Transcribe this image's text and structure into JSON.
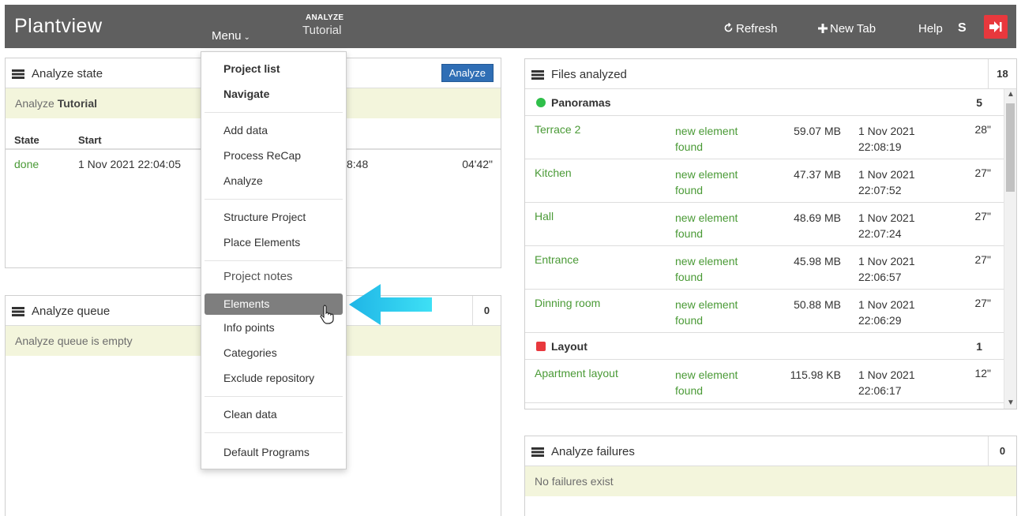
{
  "topbar": {
    "brand": "Plantview",
    "menu_label": "Menu",
    "crumb_small": "ANALYZE",
    "crumb_big": "Tutorial",
    "refresh": "Refresh",
    "new_tab": "New Tab",
    "help": "Help",
    "user": "S"
  },
  "state_panel": {
    "title": "Analyze state",
    "analyze_button": "Analyze",
    "note_prefix": "Analyze",
    "note_project": "Tutorial",
    "col_state": "State",
    "col_start": "Start",
    "row_state": "done",
    "row_start": "1 Nov 2021 22:04:05",
    "row_end_partial": "8:48",
    "row_duration": "04'42\""
  },
  "queue_panel": {
    "title": "Analyze queue",
    "count": "0",
    "note": "Analyze queue is empty"
  },
  "files_panel": {
    "title": "Files analyzed",
    "count": "18",
    "groups": [
      {
        "name": "Panoramas",
        "count": "5",
        "color": "#2fbf4a",
        "rows": [
          {
            "name": "Terrace 2",
            "status": "new element found",
            "size": "59.07 MB",
            "date": "1 Nov 2021 22:08:19",
            "time": "28\""
          },
          {
            "name": "Kitchen",
            "status": "new element found",
            "size": "47.37 MB",
            "date": "1 Nov 2021 22:07:52",
            "time": "27\""
          },
          {
            "name": "Hall",
            "status": "new element found",
            "size": "48.69 MB",
            "date": "1 Nov 2021 22:07:24",
            "time": "27\""
          },
          {
            "name": "Entrance",
            "status": "new element found",
            "size": "45.98 MB",
            "date": "1 Nov 2021 22:06:57",
            "time": "27\""
          },
          {
            "name": "Dinning room",
            "status": "new element found",
            "size": "50.88 MB",
            "date": "1 Nov 2021 22:06:29",
            "time": "27\""
          }
        ]
      },
      {
        "name": "Layout",
        "count": "1",
        "color": "#e8383d",
        "rows": [
          {
            "name": "Apartment layout",
            "status": "new element found",
            "size": "115.98 KB",
            "date": "1 Nov 2021 22:06:17",
            "time": "12\""
          }
        ]
      }
    ]
  },
  "failures_panel": {
    "title": "Analyze failures",
    "count": "0",
    "note": "No failures exist"
  },
  "menu": {
    "project_list": "Project list",
    "navigate": "Navigate",
    "add_data": "Add data",
    "process_recap": "Process ReCap",
    "analyze": "Analyze",
    "structure_project": "Structure Project",
    "place_elements": "Place Elements",
    "project_notes": "Project notes",
    "elements": "Elements",
    "info_points": "Info points",
    "categories": "Categories",
    "exclude_repository": "Exclude repository",
    "clean_data": "Clean data",
    "default_programs": "Default Programs"
  },
  "colors": {
    "topbar": "#5f5f5f",
    "accent_green": "#4a9a36",
    "button_blue": "#2f6eb5",
    "note_bg": "#f3f5dc",
    "arrow_cyan": "#29c3ea",
    "logout_red": "#e8383d"
  }
}
